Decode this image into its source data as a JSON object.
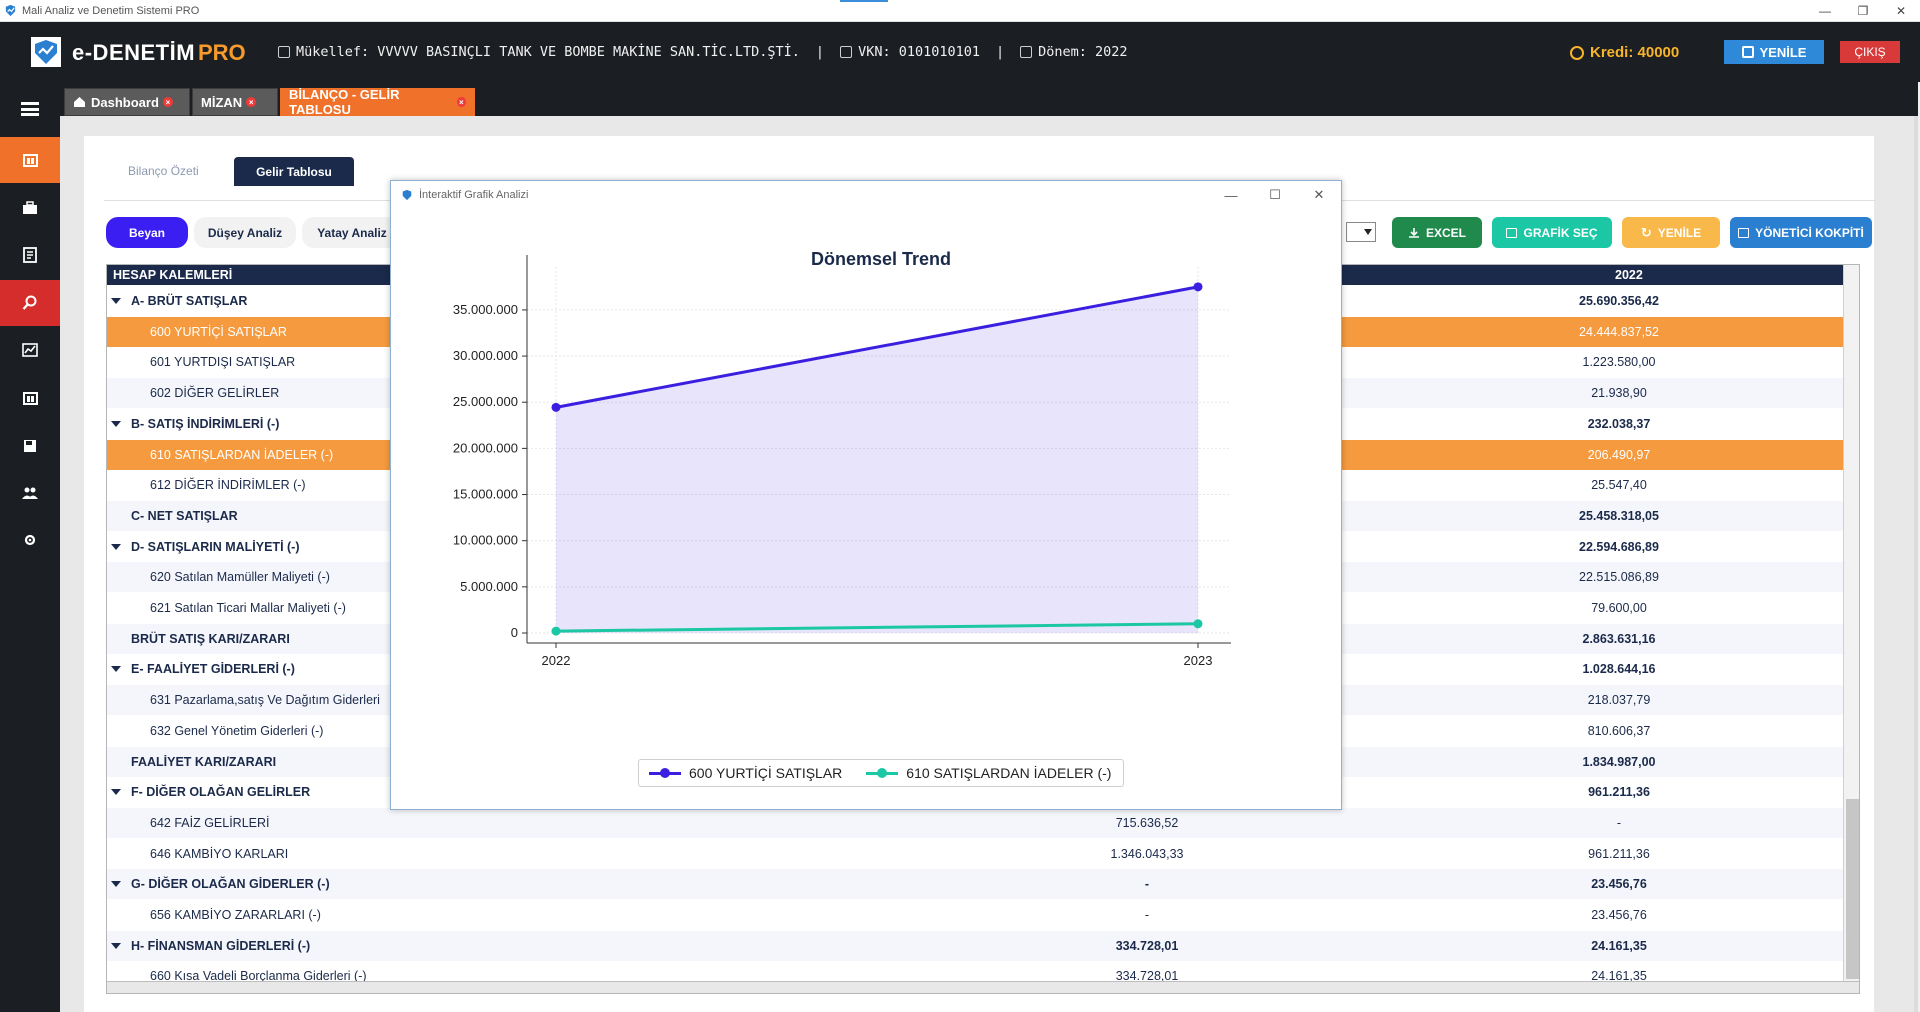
{
  "window": {
    "title": "Mali Analiz ve Denetim Sistemi PRO",
    "controls": [
      "—",
      "❐",
      "✕"
    ]
  },
  "header": {
    "brand": "e-DENETİM",
    "brand_suffix": "PRO",
    "mukellef": "Mükellef: VVVVV BASINÇLI TANK VE BOMBE MAKİNE SAN.TİC.LTD.ŞTİ.",
    "vkn": "VKN: 0101010101",
    "donem": "Dönem: 2022",
    "separator": "|",
    "kredi": "Kredi: 40000",
    "yenile_label": "YENİLE",
    "cikis_label": "ÇIKIŞ",
    "accent_color": "#f59a2b"
  },
  "sidebar": {
    "items": [
      {
        "icon": "menu-icon"
      },
      {
        "icon": "ledger-icon",
        "active": "orange"
      },
      {
        "icon": "briefcase-icon"
      },
      {
        "icon": "document-icon"
      },
      {
        "icon": "search-icon",
        "active": "red"
      },
      {
        "icon": "chart-icon"
      },
      {
        "icon": "ledger-icon"
      },
      {
        "icon": "save-icon"
      },
      {
        "icon": "users-icon"
      },
      {
        "icon": "gear-icon"
      }
    ]
  },
  "tabs": [
    {
      "label": "Dashboard"
    },
    {
      "label": "MİZAN"
    },
    {
      "label": "BİLANÇO - GELİR TABLOSU",
      "active": true
    }
  ],
  "subtabs": {
    "plain": "Bilanço Özeti",
    "active": "Gelir Tablosu"
  },
  "view_pills": {
    "beyan": "Beyan",
    "dusey": "Düşey Analiz",
    "yatay": "Yatay Analiz"
  },
  "actions": {
    "excel": "EXCEL",
    "grafik": "GRAFİK SEÇ",
    "yenile": "YENİLE",
    "kokpit": "YÖNETİCİ KOKPİTİ",
    "colors": {
      "excel": "#1f8a4c",
      "grafik": "#1cc7a6",
      "yenile": "#f8b84a",
      "kokpit": "#2a7fd0"
    }
  },
  "table": {
    "headers": {
      "col1": "HESAP KALEMLERİ",
      "col3": "2022"
    },
    "rows": [
      {
        "label": "A- BRÜT SATIŞLAR",
        "v2": "",
        "v3": "25.690.356,42",
        "level": 0,
        "bold": true,
        "expand": true
      },
      {
        "label": "600 YURTİÇİ SATIŞLAR",
        "v2": "",
        "v3": "24.444.837,52",
        "level": 1,
        "highlight": true
      },
      {
        "label": "601 YURTDIŞI SATIŞLAR",
        "v2": "",
        "v3": "1.223.580,00",
        "level": 1
      },
      {
        "label": "602 DİĞER GELİRLER",
        "v2": "",
        "v3": "21.938,90",
        "level": 1
      },
      {
        "label": "B- SATIŞ İNDİRİMLERİ (-)",
        "v2": "",
        "v3": "232.038,37",
        "level": 0,
        "bold": true,
        "expand": true
      },
      {
        "label": "610 SATIŞLARDAN İADELER (-)",
        "v2": "",
        "v3": "206.490,97",
        "level": 1,
        "highlight": true
      },
      {
        "label": "612 DİĞER İNDİRİMLER (-)",
        "v2": "",
        "v3": "25.547,40",
        "level": 1
      },
      {
        "label": "C- NET SATIŞLAR",
        "v2": "",
        "v3": "25.458.318,05",
        "level": 0,
        "bold": true
      },
      {
        "label": "D- SATIŞLARIN MALİYETİ (-)",
        "v2": "",
        "v3": "22.594.686,89",
        "level": 0,
        "bold": true,
        "expand": true
      },
      {
        "label": "620 Satılan Mamüller Maliyeti (-)",
        "v2": "",
        "v3": "22.515.086,89",
        "level": 1
      },
      {
        "label": "621 Satılan Ticari Mallar Maliyeti (-)",
        "v2": "",
        "v3": "79.600,00",
        "level": 1
      },
      {
        "label": "BRÜT SATIŞ KARI/ZARARI",
        "v2": "",
        "v3": "2.863.631,16",
        "level": 0,
        "bold": true
      },
      {
        "label": "E- FAALİYET GİDERLERİ (-)",
        "v2": "",
        "v3": "1.028.644,16",
        "level": 0,
        "bold": true,
        "expand": true
      },
      {
        "label": "631 Pazarlama,satış Ve Dağıtım Giderleri",
        "v2": "",
        "v3": "218.037,79",
        "level": 1
      },
      {
        "label": "632 Genel Yönetim Giderleri (-)",
        "v2": "",
        "v3": "810.606,37",
        "level": 1
      },
      {
        "label": "FAALİYET KARI/ZARARI",
        "v2": "",
        "v3": "1.834.987,00",
        "level": 0,
        "bold": true
      },
      {
        "label": "F- DİĞER OLAĞAN GELİRLER",
        "v2": "",
        "v3": "961.211,36",
        "level": 0,
        "bold": true,
        "expand": true
      },
      {
        "label": "642 FAİZ GELİRLERİ",
        "v2": "715.636,52",
        "v3": "-",
        "level": 1
      },
      {
        "label": "646 KAMBİYO KARLARI",
        "v2": "1.346.043,33",
        "v3": "961.211,36",
        "level": 1
      },
      {
        "label": "G- DİĞER OLAĞAN GİDERLER (-)",
        "v2": "-",
        "v3": "23.456,76",
        "level": 0,
        "bold": true,
        "expand": true
      },
      {
        "label": "656 KAMBİYO ZARARLARI (-)",
        "v2": "-",
        "v3": "23.456,76",
        "level": 1
      },
      {
        "label": "H- FİNANSMAN GİDERLERİ (-)",
        "v2": "334.728,01",
        "v3": "24.161,35",
        "level": 0,
        "bold": true,
        "expand": true
      },
      {
        "label": "660 Kısa Vadeli Borçlanma Giderleri (-)",
        "v2": "334.728,01",
        "v3": "24.161,35",
        "level": 1
      }
    ]
  },
  "dialog": {
    "title": "İnteraktif Grafik Analizi"
  },
  "chart_data": {
    "type": "line",
    "title": "Dönemsel Trend",
    "xlabel": "",
    "ylabel": "",
    "categories": [
      "2022",
      "2023"
    ],
    "ylim": [
      0,
      39000000
    ],
    "yticks": [
      0,
      5000000,
      10000000,
      15000000,
      20000000,
      25000000,
      30000000,
      35000000
    ],
    "ytick_labels": [
      "0",
      "5.000.000",
      "10.000.000",
      "15.000.000",
      "20.000.000",
      "25.000.000",
      "30.000.000",
      "35.000.000"
    ],
    "grid": true,
    "legend": "bottom-center",
    "series": [
      {
        "name": "600 YURTİÇİ SATIŞLAR",
        "values": [
          24444837.52,
          37500000
        ],
        "color": "#3b1fe0",
        "fill": true
      },
      {
        "name": "610 SATIŞLARDAN İADELER (-)",
        "values": [
          206490.97,
          1000000
        ],
        "color": "#1cc7a6",
        "fill": false
      }
    ]
  }
}
